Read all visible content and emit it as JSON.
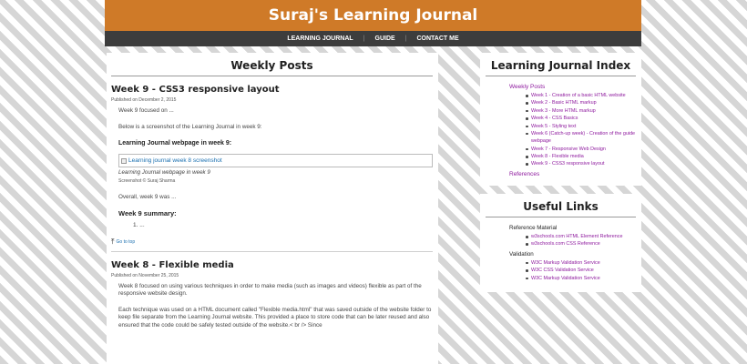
{
  "header": {
    "title": "Suraj's Learning Journal"
  },
  "nav": {
    "items": [
      "LEARNING JOURNAL",
      "GUIDE",
      "CONTACT ME"
    ],
    "separator": "|"
  },
  "main": {
    "heading": "Weekly Posts",
    "posts": [
      {
        "title": "Week 9 - CSS3 responsive layout",
        "date": "Published on December 2, 2015",
        "p1": "Week 9 focused on ...",
        "p2": "Below is a screenshot of the Learning Journal in week 9:",
        "image_label": "Learning Journal webpage in week 9:",
        "image_alt": "Learning journal week 8 screenshot",
        "caption": "Learning Journal webpage in week 9",
        "credit": "Screenshot © Suraj Sharma",
        "p3": "Overall, week 9 was ...",
        "summary_heading": "Week 9 summary:",
        "summary_item": "1.   ...",
        "top_link": "Go to top"
      },
      {
        "title": "Week 8 - Flexible media",
        "date": "Published on November 25, 2015",
        "p1": "Week 8 focused on using various techniques in order to make media (such as images and videos) flexible as part of the responsive website design.",
        "p2": "Each technique was used on a HTML document called \"Flexible media.html\" that was saved outside of the website folder to keep file separate from the Learning Journal website. This provided a place to store code that can be later reused and also ensured that the code could be safely tested outside of the website.< br /> Since"
      }
    ]
  },
  "index": {
    "heading": "Learning Journal Index",
    "weekly_label": "Weekly Posts",
    "weeks": [
      "Week 1 - Creation of a basic HTML website",
      "Week 2 - Basic HTML markup",
      "Week 3 - More HTML markup",
      "Week 4 - CSS Basics",
      "Week 5 - Styling text",
      "Week 6 (Catch-up week) - Creation of the guide webpage",
      "Week 7 - Responsive Web Design",
      "Week 8 - Flexible media",
      "Week 9 - CSS3 responsive layout"
    ],
    "references_label": "References"
  },
  "useful_links": {
    "heading": "Useful Links",
    "groups": [
      {
        "name": "Reference Material",
        "links": [
          "w3schools.com HTML Element Reference",
          "w3schools.com CSS Reference"
        ]
      },
      {
        "name": "Validation",
        "links": [
          "W3C Markup Validation Service",
          "W3C CSS Validation Service",
          "W3C Markup Validation Service"
        ]
      }
    ]
  },
  "colors": {
    "header_bg": "#cf7a28",
    "nav_bg": "#3d3d3d",
    "link_purple": "#8e1a9e",
    "link_blue": "#1a6fb0"
  },
  "icons": {
    "top_link_icon": "arrow-up-to-line-icon",
    "broken_image_icon": "broken-image-icon"
  }
}
